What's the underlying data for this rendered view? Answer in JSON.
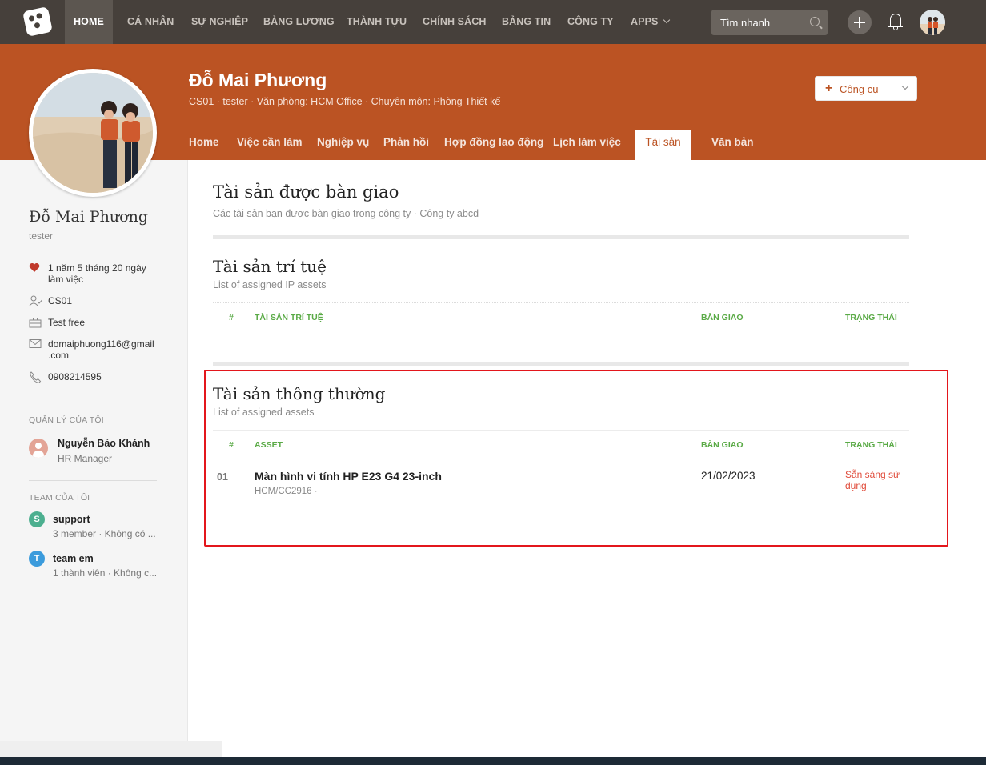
{
  "nav": {
    "items": [
      "HOME",
      "CÁ NHÂN",
      "SỰ NGHIỆP",
      "BẢNG LƯƠNG",
      "THÀNH TỰU",
      "CHÍNH SÁCH",
      "BẢNG TIN",
      "CÔNG TY",
      "APPS"
    ],
    "active": "HOME",
    "search_placeholder": "Tìm nhanh"
  },
  "header": {
    "name": "Đỗ Mai Phương",
    "subtitle": "CS01 · tester · Văn phòng: HCM Office · Chuyên môn: Phòng Thiết kế",
    "tools_label": "Công cụ",
    "tabs": [
      "Home",
      "Việc cần làm",
      "Nghiệp vụ",
      "Phản hồi",
      "Hợp đồng lao động",
      "Lịch làm việc",
      "Tài sản",
      "Văn bản"
    ],
    "active_tab": "Tài sản"
  },
  "sidebar": {
    "name": "Đỗ Mai Phương",
    "role": "tester",
    "tenure": "1 năm 5 tháng 20 ngày\nlàm việc",
    "code": "CS01",
    "plan": "Test free",
    "email": "domaiphuong116@gmail\n.com",
    "phone": "0908214595",
    "manager_heading": "QUẢN LÝ CỦA TÔI",
    "manager_name": "Nguyễn Bảo Khánh",
    "manager_title": "HR Manager",
    "team_heading": "TEAM CỦA TÔI",
    "teams": [
      {
        "initial": "S",
        "name": "support",
        "meta": "3 member · Không có ...",
        "color": "#4caf8f"
      },
      {
        "initial": "T",
        "name": "team em",
        "meta": "1 thành viên · Không c...",
        "color": "#3b9bdc"
      }
    ]
  },
  "main": {
    "title": "Tài sản được bàn giao",
    "subtitle": "Các tài sản bạn được bàn giao trong công ty · Công ty abcd",
    "ip_section": {
      "title": "Tài sản trí tuệ",
      "subtitle": "List of assigned IP assets",
      "columns": [
        "#",
        "TÀI SẢN TRÍ TUỆ",
        "BÀN GIAO",
        "TRẠNG THÁI"
      ]
    },
    "asset_section": {
      "title": "Tài sản thông thường",
      "subtitle": "List of assigned assets",
      "columns": [
        "#",
        "ASSET",
        "BÀN GIAO",
        "TRẠNG THÁI"
      ],
      "rows": [
        {
          "num": "01",
          "name": "Màn hình vi tính HP E23 G4 23-inch",
          "code": "HCM/CC2916 ·",
          "date": "21/02/2023",
          "status": "Sẵn sàng sử dụng"
        }
      ]
    }
  },
  "colors": {
    "brand": "#bb5323",
    "nav_bg": "#46403b",
    "table_header": "#5aaa46",
    "status_ready": "#e04b3a",
    "highlight": "#e3161c"
  },
  "icons": [
    "logo-icon",
    "search-icon",
    "plus-icon",
    "bell-icon",
    "heart-icon",
    "user-check-icon",
    "briefcase-icon",
    "mail-icon",
    "phone-icon",
    "chevron-down-icon"
  ]
}
